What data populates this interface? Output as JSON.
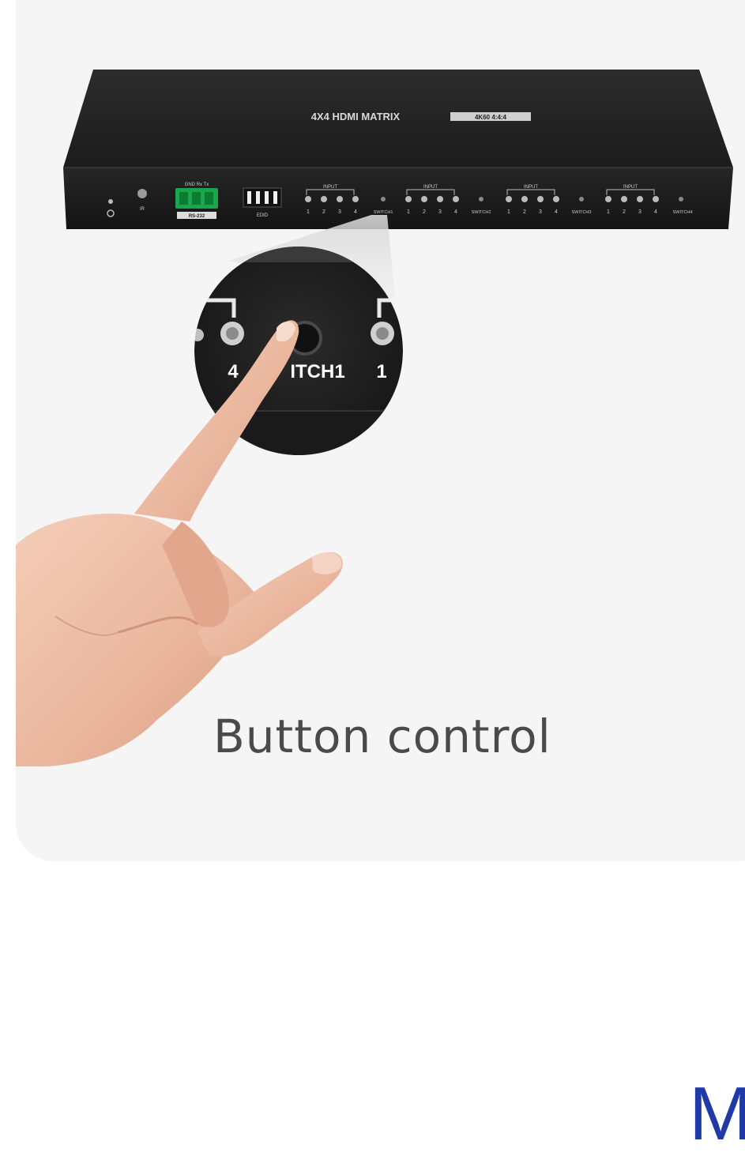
{
  "device": {
    "top_label": "4X4 HDMI MATRIX",
    "sub_badge": "4K60 4:4:4",
    "rs232_label": "RS-232",
    "pin_labels": "GND Rx Tx",
    "edid_label": "EDID",
    "input_group_label": "INPUT",
    "port_numbers": [
      "1",
      "2",
      "3",
      "4"
    ],
    "switch_labels": [
      "SWITCH1",
      "SWITCH2",
      "SWITCH3",
      "SWITCH4"
    ],
    "ir_label": "IR"
  },
  "zoom": {
    "left_number": "4",
    "switch_text": "ITCH1",
    "right_number": "1"
  },
  "caption": "Button control",
  "brand_partial": "M",
  "colors": {
    "background": "#ffffff",
    "card": "#f5f5f5",
    "device_body": "#232323",
    "terminal_green": "#1aa64a",
    "caption": "#4a4a4a",
    "brand": "#1f3aa8"
  }
}
